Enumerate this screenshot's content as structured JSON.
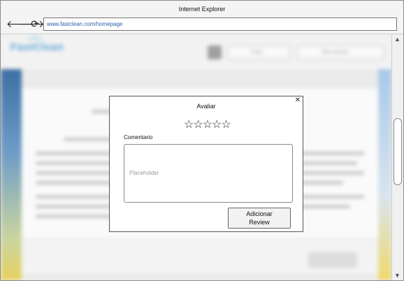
{
  "window": {
    "title": "Internet Explorer"
  },
  "browser": {
    "back": "🡐",
    "forward": "🡒",
    "refresh": "⟳",
    "url": "www.fastclean.com/homepage"
  },
  "background": {
    "logo": "FastClean",
    "select_user": "Célio",
    "select_bookings": "Marcações",
    "accent_color": "#5ea8d8"
  },
  "modal": {
    "title": "Avaliar",
    "close": "✕",
    "stars": [
      "☆",
      "☆",
      "☆",
      "☆",
      "☆"
    ],
    "comment_label": "Comentario",
    "comment_placeholder": "Placeholder",
    "submit_line1": "Adicionar",
    "submit_line2": "Review"
  },
  "scrollbar": {
    "up": "▲",
    "down": "▼"
  }
}
